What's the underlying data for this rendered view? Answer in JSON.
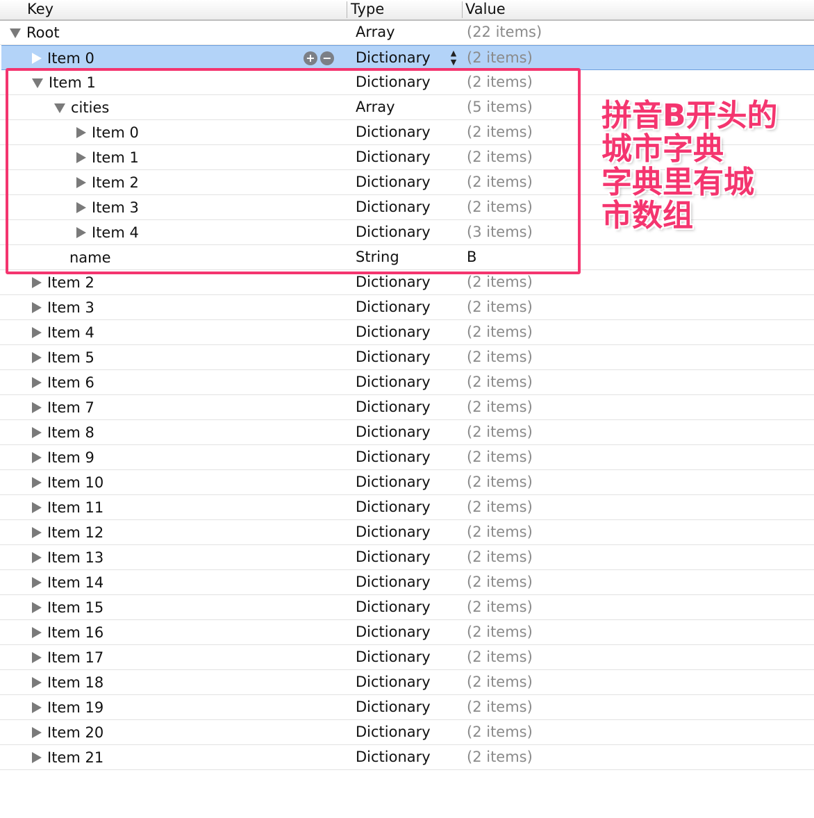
{
  "header": {
    "key": "Key",
    "type": "Type",
    "value": "Value"
  },
  "rows": [
    {
      "key": "Root",
      "type": "Array",
      "value": "(22 items)",
      "indent": 0,
      "tri": "open"
    },
    {
      "key": "Item 0",
      "type": "Dictionary",
      "value": "(2 items)",
      "indent": 1,
      "tri": "closed",
      "selected": true
    },
    {
      "key": "Item 1",
      "type": "Dictionary",
      "value": "(2 items)",
      "indent": 1,
      "tri": "open"
    },
    {
      "key": "cities",
      "type": "Array",
      "value": "(5 items)",
      "indent": 2,
      "tri": "open"
    },
    {
      "key": "Item 0",
      "type": "Dictionary",
      "value": "(2 items)",
      "indent": 3,
      "tri": "closed"
    },
    {
      "key": "Item 1",
      "type": "Dictionary",
      "value": "(2 items)",
      "indent": 3,
      "tri": "closed"
    },
    {
      "key": "Item 2",
      "type": "Dictionary",
      "value": "(2 items)",
      "indent": 3,
      "tri": "closed"
    },
    {
      "key": "Item 3",
      "type": "Dictionary",
      "value": "(2 items)",
      "indent": 3,
      "tri": "closed"
    },
    {
      "key": "Item 4",
      "type": "Dictionary",
      "value": "(3 items)",
      "indent": 3,
      "tri": "closed"
    },
    {
      "key": "name",
      "type": "String",
      "value": "B",
      "indent": 2,
      "tri": "none",
      "plain": true
    },
    {
      "key": "Item 2",
      "type": "Dictionary",
      "value": "(2 items)",
      "indent": 1,
      "tri": "closed"
    },
    {
      "key": "Item 3",
      "type": "Dictionary",
      "value": "(2 items)",
      "indent": 1,
      "tri": "closed"
    },
    {
      "key": "Item 4",
      "type": "Dictionary",
      "value": "(2 items)",
      "indent": 1,
      "tri": "closed"
    },
    {
      "key": "Item 5",
      "type": "Dictionary",
      "value": "(2 items)",
      "indent": 1,
      "tri": "closed"
    },
    {
      "key": "Item 6",
      "type": "Dictionary",
      "value": "(2 items)",
      "indent": 1,
      "tri": "closed"
    },
    {
      "key": "Item 7",
      "type": "Dictionary",
      "value": "(2 items)",
      "indent": 1,
      "tri": "closed"
    },
    {
      "key": "Item 8",
      "type": "Dictionary",
      "value": "(2 items)",
      "indent": 1,
      "tri": "closed"
    },
    {
      "key": "Item 9",
      "type": "Dictionary",
      "value": "(2 items)",
      "indent": 1,
      "tri": "closed"
    },
    {
      "key": "Item 10",
      "type": "Dictionary",
      "value": "(2 items)",
      "indent": 1,
      "tri": "closed"
    },
    {
      "key": "Item 11",
      "type": "Dictionary",
      "value": "(2 items)",
      "indent": 1,
      "tri": "closed"
    },
    {
      "key": "Item 12",
      "type": "Dictionary",
      "value": "(2 items)",
      "indent": 1,
      "tri": "closed"
    },
    {
      "key": "Item 13",
      "type": "Dictionary",
      "value": "(2 items)",
      "indent": 1,
      "tri": "closed"
    },
    {
      "key": "Item 14",
      "type": "Dictionary",
      "value": "(2 items)",
      "indent": 1,
      "tri": "closed"
    },
    {
      "key": "Item 15",
      "type": "Dictionary",
      "value": "(2 items)",
      "indent": 1,
      "tri": "closed"
    },
    {
      "key": "Item 16",
      "type": "Dictionary",
      "value": "(2 items)",
      "indent": 1,
      "tri": "closed"
    },
    {
      "key": "Item 17",
      "type": "Dictionary",
      "value": "(2 items)",
      "indent": 1,
      "tri": "closed"
    },
    {
      "key": "Item 18",
      "type": "Dictionary",
      "value": "(2 items)",
      "indent": 1,
      "tri": "closed"
    },
    {
      "key": "Item 19",
      "type": "Dictionary",
      "value": "(2 items)",
      "indent": 1,
      "tri": "closed"
    },
    {
      "key": "Item 20",
      "type": "Dictionary",
      "value": "(2 items)",
      "indent": 1,
      "tri": "closed"
    },
    {
      "key": "Item 21",
      "type": "Dictionary",
      "value": "(2 items)",
      "indent": 1,
      "tri": "closed"
    }
  ],
  "row_controls": {
    "add_icon": "plus-circle-icon",
    "remove_icon": "minus-circle-icon",
    "stepper_icon": "up-down-stepper-icon"
  },
  "annotation": {
    "lines": [
      "拼音B开头的",
      "城市字典",
      "字典里有城",
      "市数组"
    ],
    "color": "#f4356f"
  }
}
